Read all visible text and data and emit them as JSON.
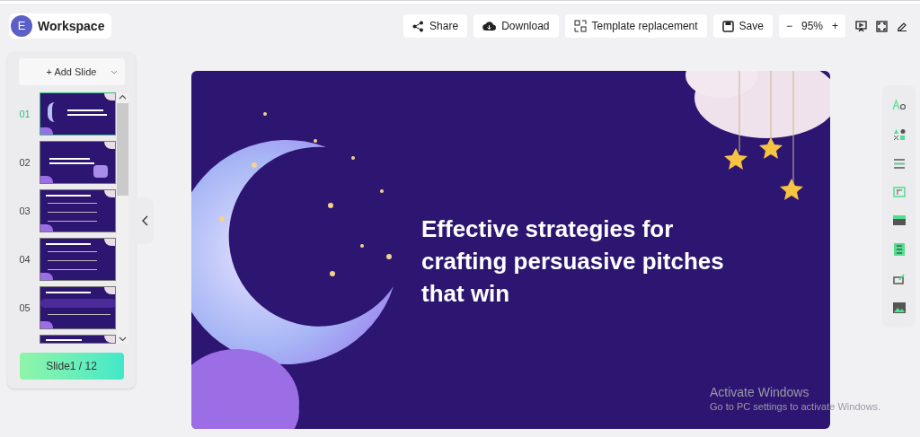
{
  "header": {
    "avatar_letter": "E",
    "title": "Workspace"
  },
  "toolbar": {
    "buttons": [
      {
        "kind": "share",
        "label": "Share"
      },
      {
        "kind": "download",
        "label": "Download"
      },
      {
        "kind": "template",
        "label": "Template replacement"
      },
      {
        "kind": "save",
        "label": "Save"
      }
    ],
    "zoom": {
      "minus": "−",
      "value": "95%",
      "plus": "+"
    }
  },
  "slides_panel": {
    "add_button": "+ Add Slide",
    "slides": [
      {
        "number": "01",
        "selected": true,
        "kind": "title"
      },
      {
        "number": "02",
        "selected": false,
        "kind": "quote"
      },
      {
        "number": "03",
        "selected": false,
        "kind": "list"
      },
      {
        "number": "04",
        "selected": false,
        "kind": "list"
      },
      {
        "number": "05",
        "selected": false,
        "kind": "wave"
      },
      {
        "selected": false,
        "kind": "partial"
      }
    ],
    "counter": "Slide1 / 12"
  },
  "slide": {
    "title": "Effective strategies for crafting persuasive pitches that win"
  },
  "right_tools": [
    {
      "kind": "text"
    },
    {
      "kind": "shapes"
    },
    {
      "kind": "lines"
    },
    {
      "kind": "frame"
    },
    {
      "kind": "banner"
    },
    {
      "kind": "table"
    },
    {
      "kind": "edit"
    },
    {
      "kind": "image"
    }
  ],
  "os_notice": {
    "title": "Activate Windows",
    "subtitle": "Go to PC settings to activate Windows."
  }
}
